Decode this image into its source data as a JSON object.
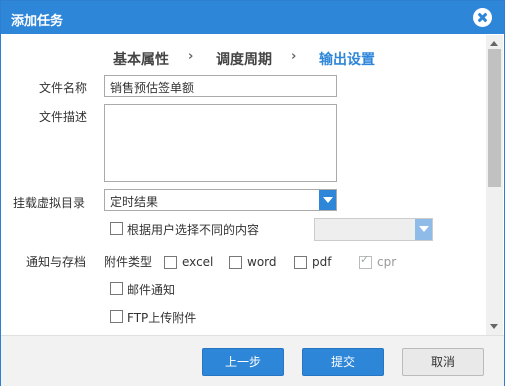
{
  "dialog": {
    "title": "添加任务"
  },
  "steps": [
    {
      "label": "基本属性"
    },
    {
      "label": "调度周期"
    },
    {
      "label": "输出设置"
    }
  ],
  "step_separator": "›",
  "form": {
    "file_name_label": "文件名称",
    "file_name_value": "销售预估签单额",
    "file_desc_label": "文件描述",
    "file_desc_value": "",
    "mount_dir_label": "挂载虚拟目录",
    "mount_dir_value": "定时结果",
    "user_select_label": "根据用户选择不同的内容",
    "user_select_value": "",
    "notify_label": "通知与存档",
    "attach_type_label": "附件类型",
    "attach_types": [
      {
        "label": "excel",
        "checked": false
      },
      {
        "label": "word",
        "checked": false
      },
      {
        "label": "pdf",
        "checked": false
      },
      {
        "label": "cpr",
        "checked": true,
        "disabled": true
      }
    ],
    "mail_notify_label": "邮件通知",
    "ftp_upload_label": "FTP上传附件"
  },
  "footer": {
    "prev_label": "上一步",
    "submit_label": "提交",
    "cancel_label": "取消"
  },
  "colors": {
    "accent": "#2e86d9"
  }
}
